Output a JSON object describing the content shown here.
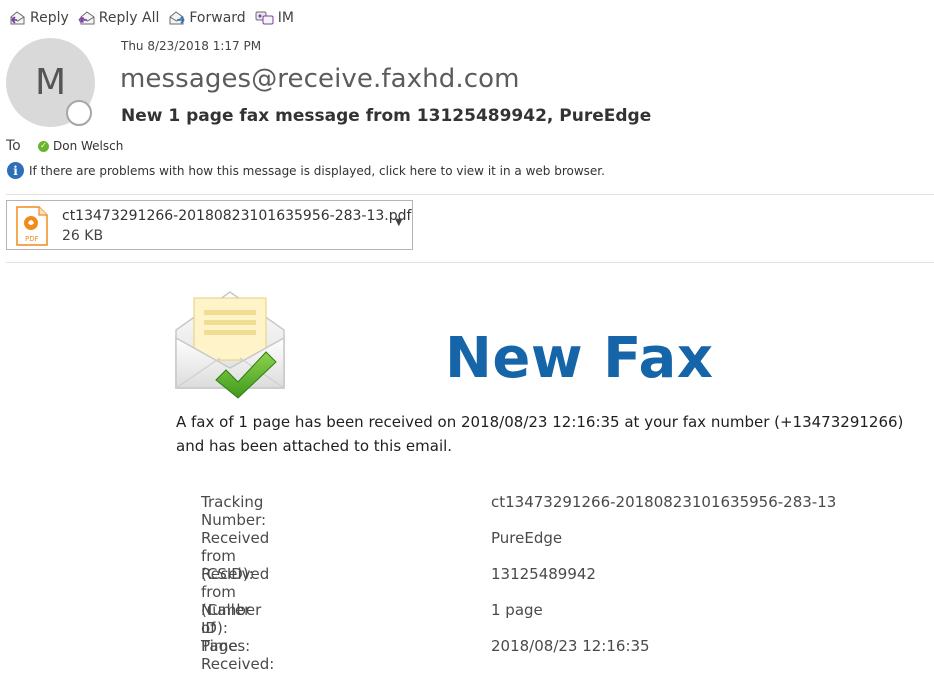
{
  "toolbar": {
    "reply": "Reply",
    "reply_all": "Reply All",
    "forward": "Forward",
    "im": "IM"
  },
  "header": {
    "avatar_initial": "M",
    "date": "Thu 8/23/2018 1:17 PM",
    "sender": "messages@receive.faxhd.com",
    "subject": "New 1 page fax message from 13125489942, PureEdge",
    "to_label": "To",
    "recipient": "Don Welsch",
    "info_text": "If there are problems with how this message is displayed, click here to view it in a web browser."
  },
  "attachment": {
    "filename": "ct13473291266-20180823101635956-283-13.pdf",
    "size": "26 KB",
    "type_label": "PDF"
  },
  "body": {
    "title": "New Fax",
    "intro": "A fax of 1 page has been received on 2018/08/23 12:16:35 at your fax number (+13473291266) and has been attached to this email.",
    "details": [
      {
        "label": "Tracking Number:",
        "value": "ct13473291266-20180823101635956-283-13"
      },
      {
        "label": "Received from (CSID):",
        "value": "PureEdge"
      },
      {
        "label": "Received from (Caller ID):",
        "value": "13125489942"
      },
      {
        "label": "Number of Pages:",
        "value": "1 page"
      },
      {
        "label": "Time Received:",
        "value": "2018/08/23 12:16:35"
      }
    ]
  },
  "icons": {
    "reply": "reply-icon",
    "reply_all": "reply-all-icon",
    "forward": "forward-icon",
    "im": "im-icon",
    "presence": "presence-icon",
    "recipient_status": "available-check-icon",
    "info": "info-icon",
    "attachment": "pdf-file-icon",
    "dropdown": "chevron-down-icon",
    "envelope": "envelope-check-icon"
  },
  "colors": {
    "title_blue": "#1565a8",
    "info_blue": "#2e6fb7",
    "presence_green": "#6bb52e",
    "pdf_orange": "#f08c1e"
  }
}
